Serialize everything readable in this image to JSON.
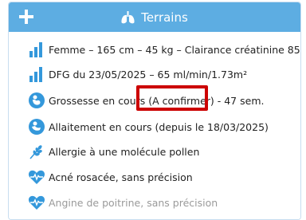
{
  "header": {
    "title": "Terrains",
    "add_icon": "plus-icon",
    "title_icon": "lungs-icon",
    "color": "#5dade2"
  },
  "items": [
    {
      "icon": "bar-chart-icon",
      "label": "Femme – 165 cm – 45 kg – Clairance créatinine 85"
    },
    {
      "icon": "bar-chart-icon",
      "label": "DFG du 23/05/2025 – 65 ml/min/1.73m²"
    },
    {
      "icon": "pregnancy-icon",
      "label": "Grossesse en cours (A confirmer) - 47 sem."
    },
    {
      "icon": "breastfeeding-icon",
      "label": "Allaitement en cours (depuis le 18/03/2025)"
    },
    {
      "icon": "wheat-icon",
      "label": "Allergie à une molécule pollen"
    },
    {
      "icon": "heart-pulse-icon",
      "label": "Acné rosacée, sans précision"
    },
    {
      "icon": "heart-pulse-icon",
      "label": "Angine de poitrine, sans précision"
    }
  ],
  "colors": {
    "icon_blue": "#3498db",
    "highlight": "#cc0000"
  }
}
